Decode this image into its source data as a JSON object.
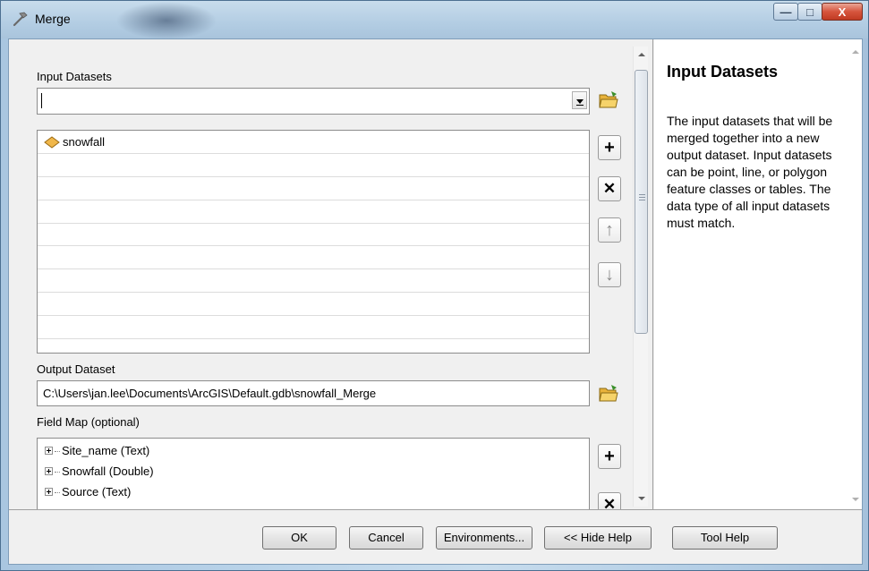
{
  "window": {
    "title": "Merge"
  },
  "input_datasets": {
    "label": "Input Datasets",
    "value": "",
    "items": [
      {
        "name": "snowfall",
        "icon": "polygon-feature-class-icon"
      }
    ]
  },
  "output_dataset": {
    "label": "Output Dataset",
    "value": "C:\\Users\\jan.lee\\Documents\\ArcGIS\\Default.gdb\\snowfall_Merge"
  },
  "field_map": {
    "label": "Field Map (optional)",
    "items": [
      {
        "label": "Site_name (Text)"
      },
      {
        "label": "Snowfall (Double)"
      },
      {
        "label": "Source (Text)"
      }
    ]
  },
  "help": {
    "title": "Input Datasets",
    "body": "The input datasets that will be merged together into a new output dataset. Input datasets can be point, line, or polygon feature classes or tables. The data type of all input datasets must match."
  },
  "footer": {
    "ok": "OK",
    "cancel": "Cancel",
    "environments": "Environments...",
    "hide_help": "<< Hide Help",
    "tool_help": "Tool Help"
  },
  "colors": {
    "title_bar": "#b3cde3",
    "close_button": "#d6553d",
    "folder_icon": "#e8b23a",
    "feature_icon": "#f0b74a"
  }
}
